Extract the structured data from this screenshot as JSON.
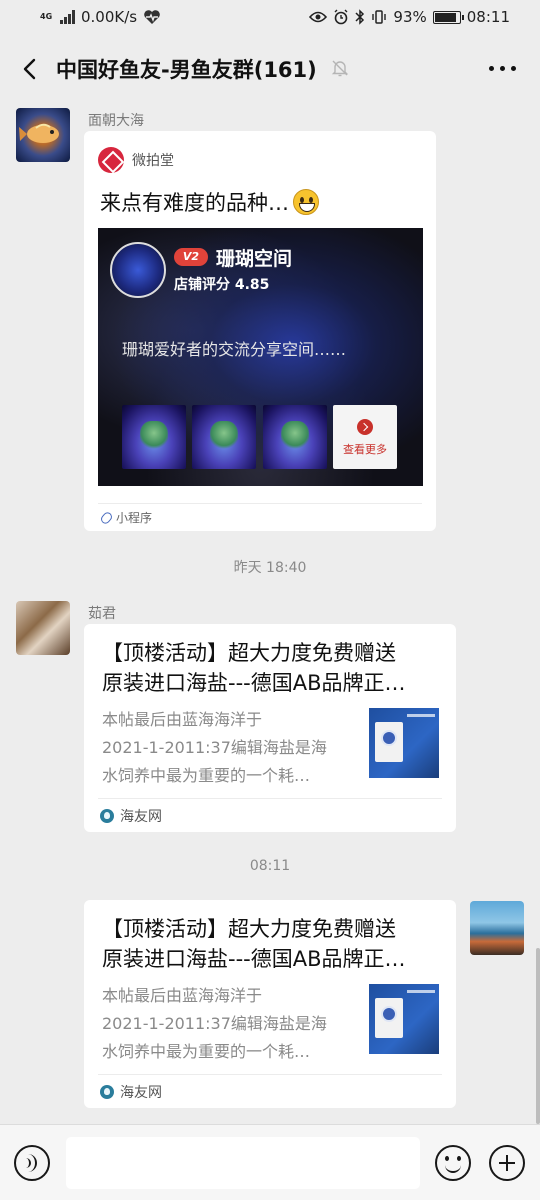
{
  "status_bar": {
    "network_type": "4G",
    "speed": "0.00K/s",
    "battery": "93%",
    "time": "08:11",
    "battery_level": 0.93
  },
  "nav": {
    "title": "中国好鱼友-男鱼友群(161)"
  },
  "messages": [
    {
      "sender": "面朝大海",
      "card_type": "mini-program",
      "source": "微拍堂",
      "title": "来点有难度的品种…",
      "shop": {
        "badge": "V2",
        "name": "珊瑚空间",
        "rating": "店铺评分 4.85",
        "description": "珊瑚爱好者的交流分享空间……",
        "see_more": "查看更多"
      },
      "footer": "小程序"
    },
    {
      "timestamp": "昨天 18:40"
    },
    {
      "sender": "茹君",
      "card_type": "article",
      "title_lines": [
        "【顶楼活动】超大力度免费赠送",
        "原装进口海盐---德国AB品牌正…"
      ],
      "desc_lines": [
        "本帖最后由蓝海海洋于",
        "2021-1-2011:37编辑海盐是海",
        "水饲养中最为重要的一个耗…"
      ],
      "footer": "海友网"
    },
    {
      "timestamp": "08:11"
    },
    {
      "sender": "self",
      "card_type": "article",
      "title_lines": [
        "【顶楼活动】超大力度免费赠送",
        "原装进口海盐---德国AB品牌正…"
      ],
      "desc_lines": [
        "本帖最后由蓝海海洋于",
        "2021-1-2011:37编辑海盐是海",
        "水饲养中最为重要的一个耗…"
      ],
      "footer": "海友网"
    }
  ],
  "input_bar": {
    "placeholder": ""
  },
  "colors": {
    "background": "#ededed",
    "card": "#ffffff",
    "badge_red": "#e0433a",
    "brand_red": "#d7263d"
  }
}
